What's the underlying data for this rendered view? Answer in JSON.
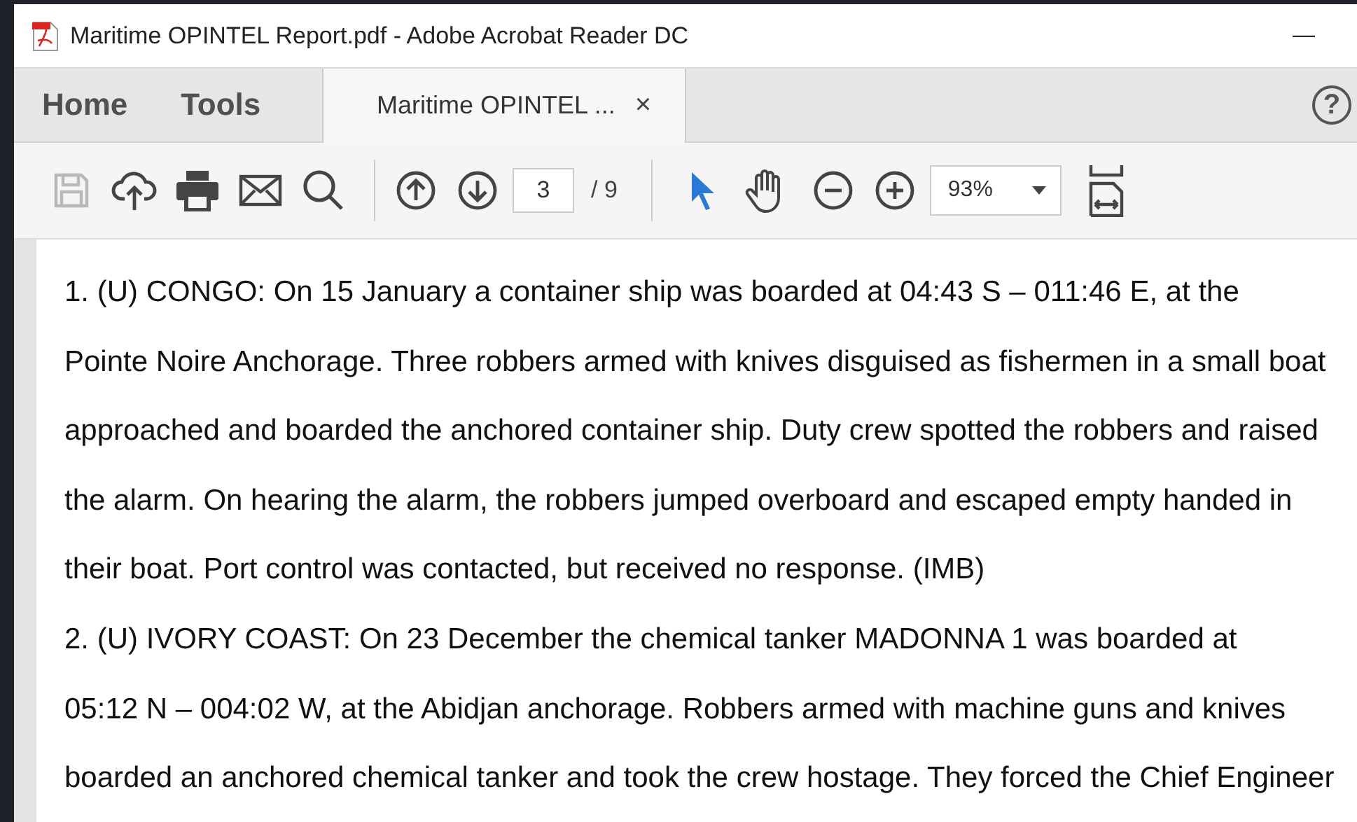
{
  "window": {
    "title": "Maritime OPINTEL Report.pdf - Adobe Acrobat Reader DC",
    "minimize": "—"
  },
  "nav": [
    {
      "label": "Home",
      "selected": false
    },
    {
      "label": "Tools",
      "selected": false
    }
  ],
  "doc_tab": {
    "label": "Maritime OPINTEL ...",
    "close": "×",
    "selected": true
  },
  "help": "?",
  "toolbar": {
    "tools": [
      {
        "kind": "save",
        "disabled": true
      },
      {
        "kind": "upload",
        "disabled": false
      },
      {
        "kind": "print",
        "disabled": false
      },
      {
        "kind": "mail",
        "disabled": false
      },
      {
        "kind": "search",
        "disabled": false
      }
    ],
    "page": {
      "value": "3",
      "total": "/ 9"
    },
    "pointers": [
      {
        "kind": "select",
        "selected": true
      },
      {
        "kind": "hand",
        "selected": false
      }
    ],
    "zoom": "93%"
  },
  "paragraphs": [
    [
      "1. (U) CONGO: On 15 January a container ship was boarded at 04:43 S – 011:46 E, at the",
      "Pointe Noire Anchorage. Three robbers armed with knives disguised as fishermen in a small boat",
      "approached and boarded the anchored container ship. Duty crew spotted the robbers and raised",
      "the alarm. On hearing the alarm, the robbers jumped overboard and escaped empty handed in",
      "their boat. Port control was contacted, but received no response. (IMB)"
    ],
    [
      "2. (U) IVORY COAST: On 23 December the chemical tanker MADONNA 1 was boarded at",
      "05:12 N – 004:02 W, at the Abidjan anchorage. Robbers armed with machine guns and knives",
      "boarded an anchored chemical tanker and took the crew hostage. They forced the Chief Engineer"
    ]
  ]
}
